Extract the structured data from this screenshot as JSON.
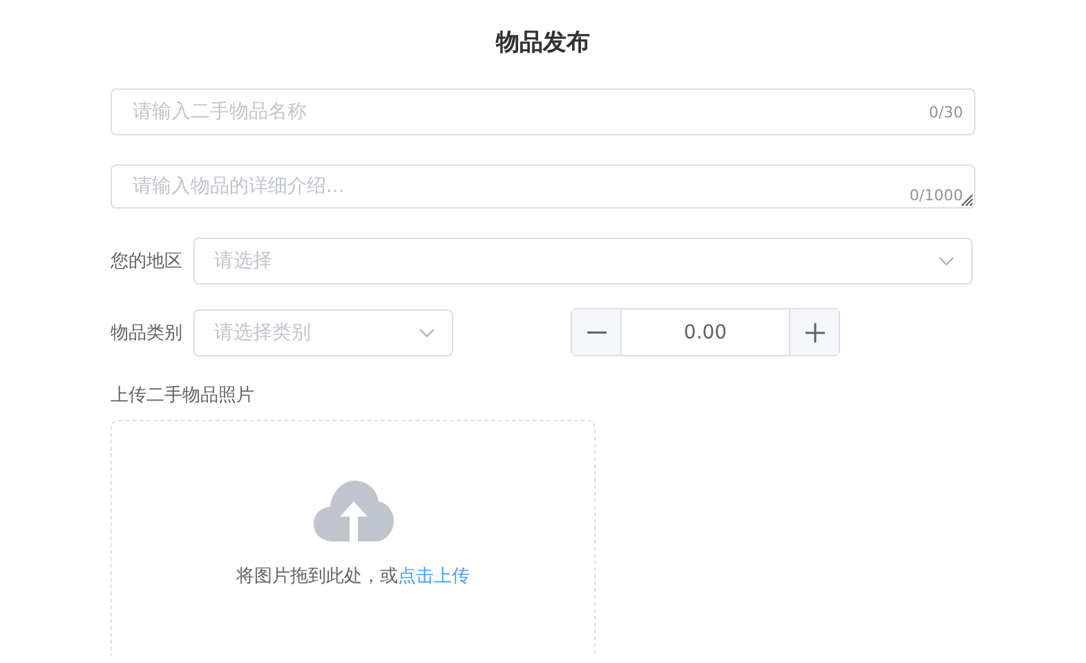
{
  "title": "物品发布",
  "name_field": {
    "placeholder": "请输入二手物品名称",
    "counter": "0/30"
  },
  "description_field": {
    "placeholder": "请输入物品的详细介绍...",
    "counter": "0/1000"
  },
  "region": {
    "label": "您的地区",
    "placeholder": "请选择"
  },
  "category": {
    "label": "物品类别",
    "placeholder": "请选择类别"
  },
  "price": {
    "value": "0.00"
  },
  "upload_label": "上传二手物品照片",
  "upload": {
    "hint": "将图片拖到此处，或",
    "link": "点击上传"
  }
}
